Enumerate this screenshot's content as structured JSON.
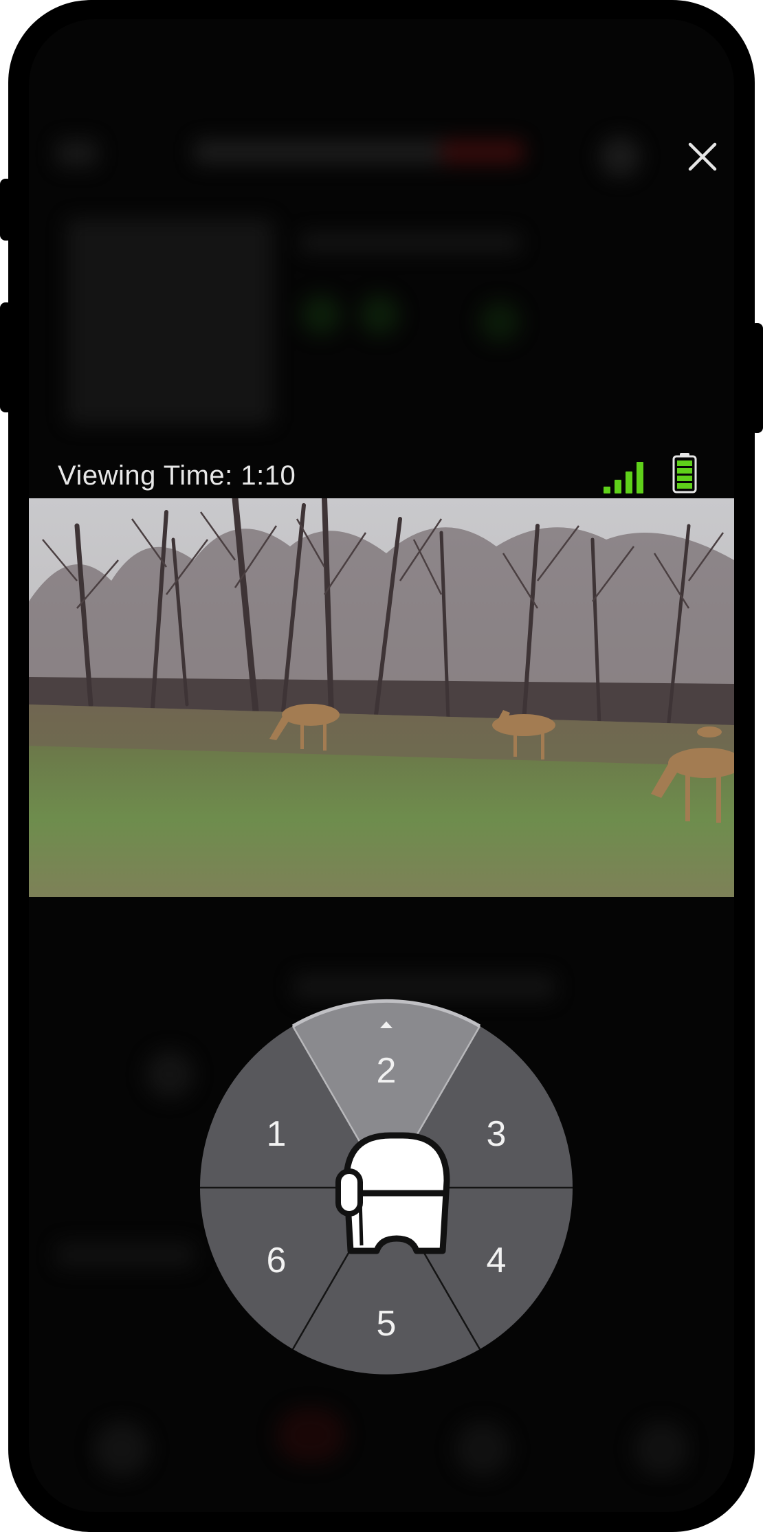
{
  "viewer": {
    "viewing_time_label": "Viewing Time: 1:10",
    "close_label": "✕"
  },
  "status": {
    "signal_bars": 4,
    "signal_color": "#5fd11a",
    "battery_level": 1.0,
    "battery_color": "#5fd11a"
  },
  "wheel": {
    "segments": [
      {
        "label": "1"
      },
      {
        "label": "2",
        "active": true
      },
      {
        "label": "3"
      },
      {
        "label": "4"
      },
      {
        "label": "5"
      },
      {
        "label": "6"
      }
    ],
    "center_icon": "camera-head-icon",
    "segment_color": "#58585c",
    "active_color": "#8a8a8e"
  },
  "video": {
    "scene_icon": "trail-camera-feed"
  }
}
